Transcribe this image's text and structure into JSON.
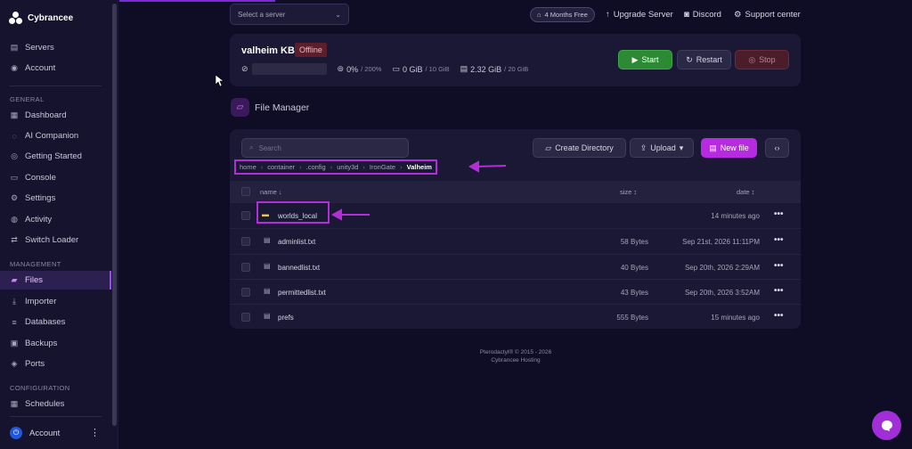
{
  "brand": {
    "name": "Cybrancee"
  },
  "sidebar": {
    "top_items": [
      {
        "label": "Servers",
        "icon": "server-icon"
      },
      {
        "label": "Account",
        "icon": "account-icon"
      }
    ],
    "general_label": "GENERAL",
    "general_items": [
      {
        "label": "Dashboard",
        "icon": "dashboard-icon"
      },
      {
        "label": "AI Companion",
        "icon": "ai-icon"
      },
      {
        "label": "Getting Started",
        "icon": "getting-started-icon"
      },
      {
        "label": "Console",
        "icon": "console-icon"
      },
      {
        "label": "Settings",
        "icon": "settings-icon"
      },
      {
        "label": "Activity",
        "icon": "activity-icon"
      },
      {
        "label": "Switch Loader",
        "icon": "switch-icon"
      }
    ],
    "management_label": "MANAGEMENT",
    "management_items": [
      {
        "label": "Files",
        "icon": "folder-icon",
        "active": true
      },
      {
        "label": "Importer",
        "icon": "import-icon"
      },
      {
        "label": "Databases",
        "icon": "database-icon"
      },
      {
        "label": "Backups",
        "icon": "backup-icon"
      },
      {
        "label": "Ports",
        "icon": "ports-icon"
      }
    ],
    "configuration_label": "CONFIGURATION",
    "configuration_items": [
      {
        "label": "Schedules",
        "icon": "schedule-icon"
      }
    ],
    "account_label": "Account"
  },
  "topbar": {
    "server_select": "Select a server",
    "promo_badge": "4 Months Free",
    "upgrade": "Upgrade Server",
    "discord": "Discord",
    "support": "Support center"
  },
  "server": {
    "name": "valheim KB",
    "status": "Offline",
    "cpu": "0%",
    "cpu_limit": "/ 200%",
    "memory": "0 GiB",
    "memory_limit": "/ 10 GiB",
    "disk": "2.32 GiB",
    "disk_limit": "/ 20 GiB",
    "start_label": "Start",
    "restart_label": "Restart",
    "stop_label": "Stop"
  },
  "file_manager": {
    "title": "File Manager",
    "search_placeholder": "Search",
    "create_dir_label": "Create Directory",
    "upload_label": "Upload",
    "new_file_label": "New file",
    "breadcrumb": [
      "home",
      "container",
      ".config",
      "unity3d",
      "IronGate"
    ],
    "breadcrumb_current": "Valheim",
    "columns": {
      "name": "name ↓",
      "size": "size ↕",
      "date": "date ↕"
    },
    "files": [
      {
        "name": "worlds_local",
        "type": "folder",
        "size": "",
        "date": "14 minutes ago"
      },
      {
        "name": "adminlist.txt",
        "type": "file",
        "size": "58 Bytes",
        "date": "Sep 21st, 2026 11:11PM"
      },
      {
        "name": "bannedlist.txt",
        "type": "file",
        "size": "40 Bytes",
        "date": "Sep 20th, 2026 2:29AM"
      },
      {
        "name": "permittedlist.txt",
        "type": "file",
        "size": "43 Bytes",
        "date": "Sep 20th, 2026 3:52AM"
      },
      {
        "name": "prefs",
        "type": "file",
        "size": "555 Bytes",
        "date": "15 minutes ago"
      }
    ]
  },
  "footer": {
    "line1": "Pterodactyl® © 2015 - 2026",
    "line2": "Cybrancee Hosting"
  },
  "colors": {
    "accent": "#b72be0",
    "annotation": "#b22fd6",
    "start": "#2c8a35",
    "offline": "#5b1e2a"
  }
}
